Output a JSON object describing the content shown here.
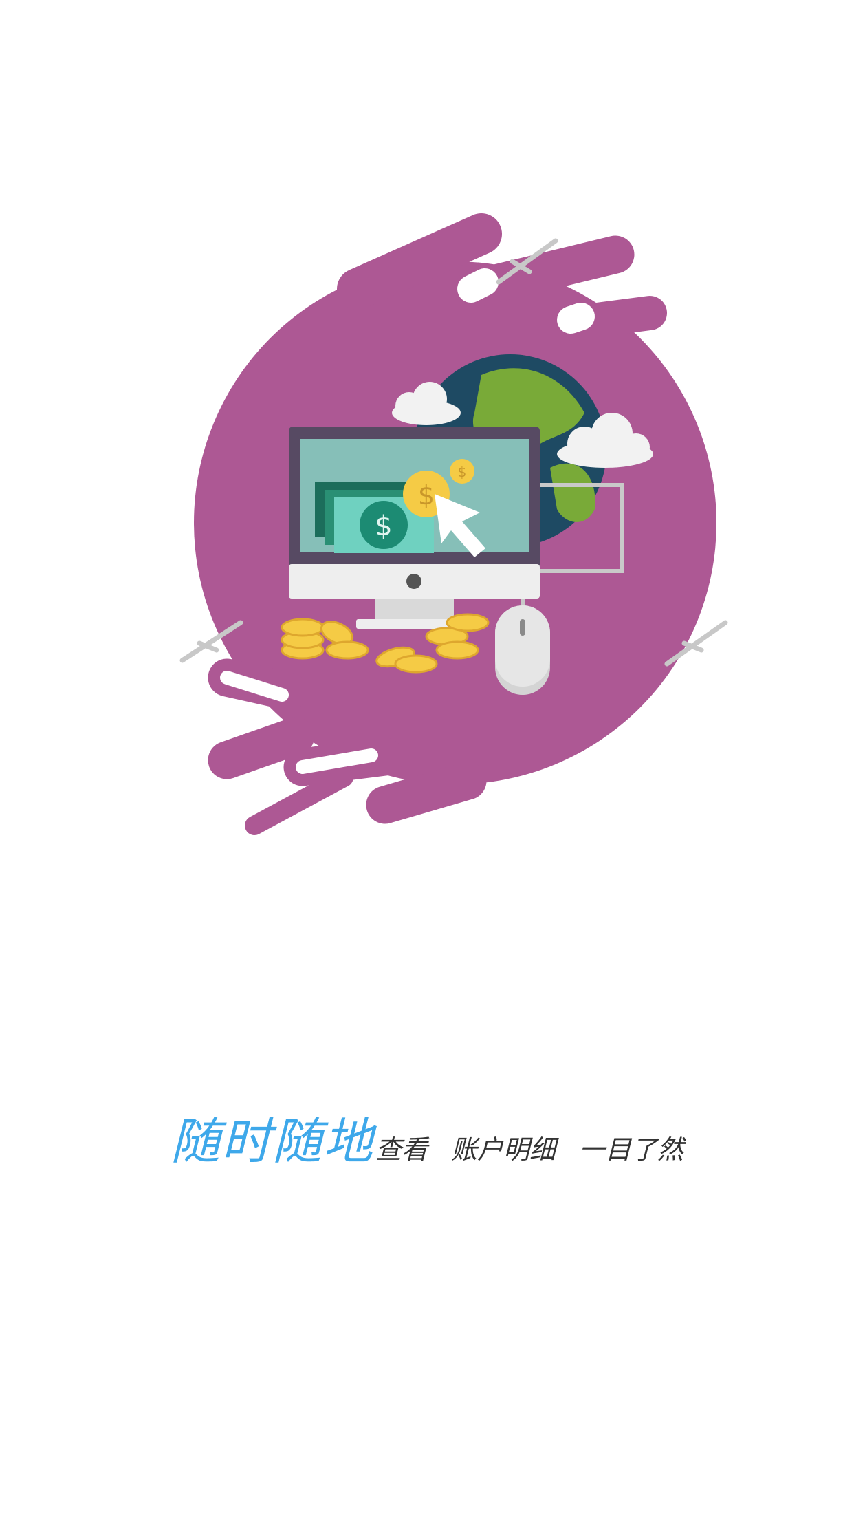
{
  "slogan": {
    "highlight": "随时随地",
    "parts": [
      "查看",
      "账户明细",
      "一目了然"
    ]
  },
  "colors": {
    "highlight": "#3ea8ea",
    "text": "#333333",
    "blob": "#ad5894",
    "screen": "#86bfb8",
    "monitor_frame": "#574a63",
    "coin": "#f5cb45",
    "globe_ocean": "#1e4a63",
    "globe_land": "#79aa38"
  },
  "illustration": {
    "icons": [
      "monitor-icon",
      "globe-icon",
      "coin-stack-icon",
      "mouse-icon",
      "cursor-arrow-icon",
      "banknote-icon",
      "cloud-icon"
    ]
  }
}
